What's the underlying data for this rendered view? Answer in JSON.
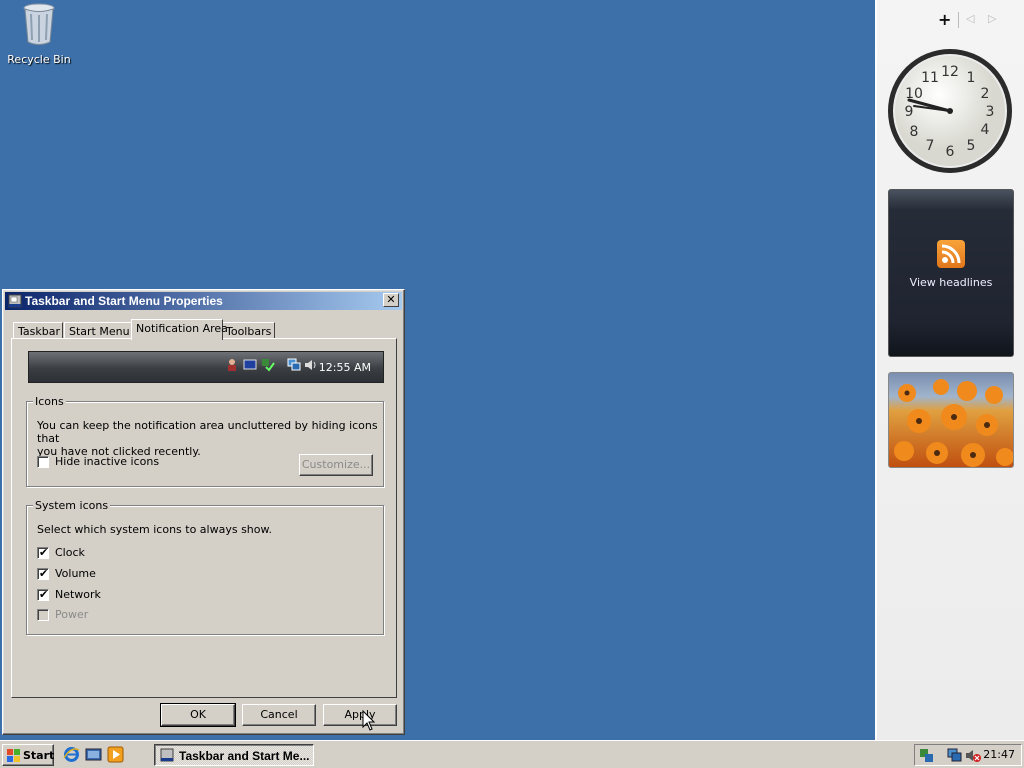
{
  "desktop": {
    "recycle_bin_label": "Recycle Bin"
  },
  "sidebar": {
    "add_gadget": "+",
    "prev": "◁",
    "next": "▷",
    "feed_text": "View headlines"
  },
  "dialog": {
    "title": "Taskbar and Start Menu Properties",
    "close_label": "✕",
    "tabs": [
      {
        "label": "Taskbar"
      },
      {
        "label": "Start Menu"
      },
      {
        "label": "Notification Area"
      },
      {
        "label": "Toolbars"
      }
    ],
    "active_tab": "Notification Area",
    "preview_time": "12:55 AM",
    "icons_group": {
      "legend": "Icons",
      "description_line1": "You can keep the notification area uncluttered by hiding icons that",
      "description_line2": "you have not clicked recently.",
      "hide_inactive_label": "Hide inactive icons",
      "hide_inactive_checked": false,
      "customize_label": "Customize..."
    },
    "system_group": {
      "legend": "System icons",
      "description": "Select which system icons to always show.",
      "items": [
        {
          "label": "Clock",
          "checked": true,
          "enabled": true
        },
        {
          "label": "Volume",
          "checked": true,
          "enabled": true
        },
        {
          "label": "Network",
          "checked": true,
          "enabled": true
        },
        {
          "label": "Power",
          "checked": false,
          "enabled": false
        }
      ]
    },
    "buttons": {
      "ok": "OK",
      "cancel": "Cancel",
      "apply": "Apply"
    }
  },
  "taskbar": {
    "start_label": "Start",
    "task_label": "Taskbar and Start Me...",
    "clock": "21:47"
  },
  "colors": {
    "desktop": "#3d70a8",
    "titlebar_start": "#0a246a",
    "titlebar_end": "#a6caf0",
    "dialog_face": "#d4d0c8"
  }
}
